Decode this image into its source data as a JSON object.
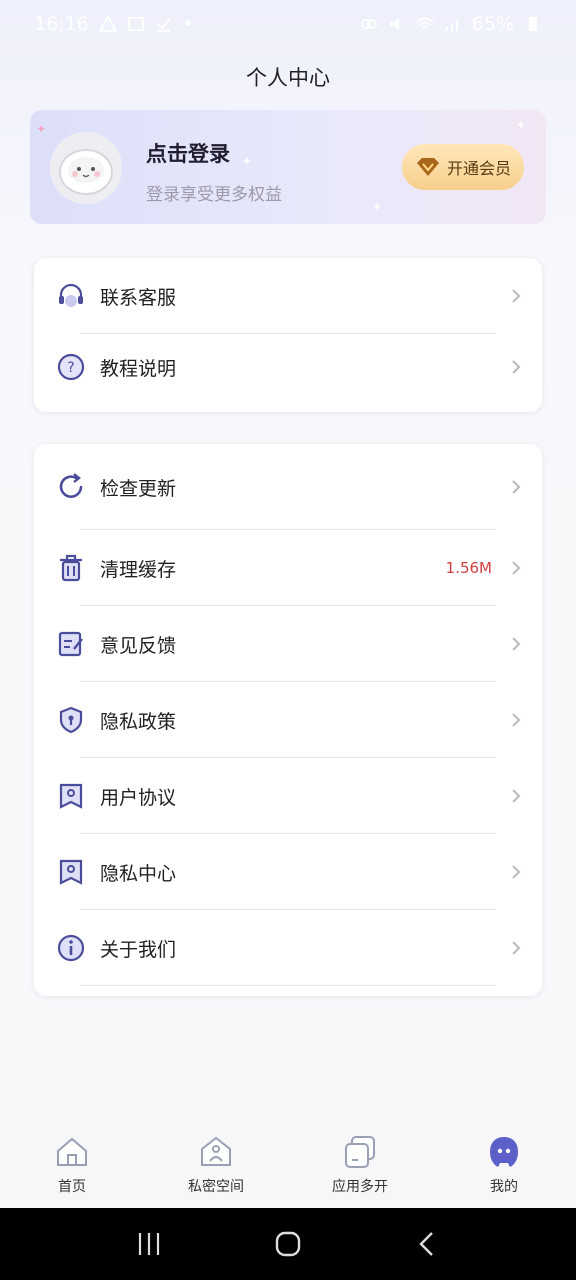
{
  "status_bar": {
    "time": "16:16",
    "battery": "65%"
  },
  "header": {
    "title": "个人中心"
  },
  "profile": {
    "login_title": "点击登录",
    "login_subtitle": "登录享受更多权益",
    "vip_button_label": "开通会员"
  },
  "menu_group_1": [
    {
      "label": "联系客服",
      "icon": "headset-icon"
    },
    {
      "label": "教程说明",
      "icon": "question-icon"
    }
  ],
  "menu_group_2": [
    {
      "label": "检查更新",
      "icon": "refresh-icon",
      "value": ""
    },
    {
      "label": "清理缓存",
      "icon": "trash-icon",
      "value": "1.56M"
    },
    {
      "label": "意见反馈",
      "icon": "feedback-icon",
      "value": ""
    },
    {
      "label": "隐私政策",
      "icon": "shield-icon",
      "value": ""
    },
    {
      "label": "用户协议",
      "icon": "bookmark-icon",
      "value": ""
    },
    {
      "label": "隐私中心",
      "icon": "bookmark-icon",
      "value": ""
    },
    {
      "label": "关于我们",
      "icon": "info-icon",
      "value": ""
    }
  ],
  "bottom_nav": [
    {
      "label": "首页",
      "icon": "home-icon",
      "active": false
    },
    {
      "label": "私密空间",
      "icon": "private-space-icon",
      "active": false
    },
    {
      "label": "应用多开",
      "icon": "multi-app-icon",
      "active": false
    },
    {
      "label": "我的",
      "icon": "profile-icon",
      "active": true
    }
  ],
  "colors": {
    "accent": "#5b5fc7",
    "cache_value": "#d14040",
    "vip_gold": "#f7cf8c"
  }
}
